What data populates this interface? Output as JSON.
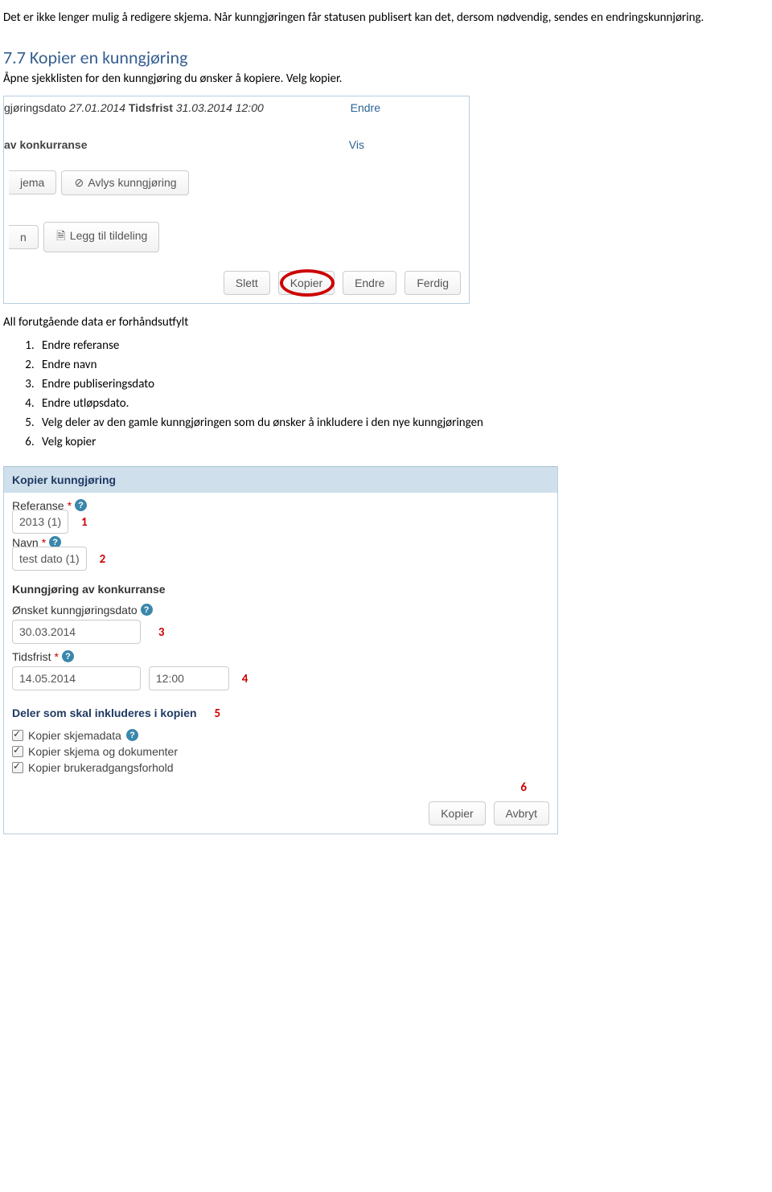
{
  "intro": {
    "p1": "Det er ikke lenger mulig å redigere skjema. Når kunngjøringen får statusen publisert kan det, dersom nødvendig, sendes en endringskunnjøring."
  },
  "section": {
    "heading": "7.7 Kopier en kunngjøring",
    "sub": "Åpne sjekklisten for den kunngjøring du ønsker å kopiere. Velg kopier."
  },
  "shot1": {
    "row1_prefix": "gjøringsdato",
    "row1_date": "27.01.2014",
    "row1_tidsfrist_label": "Tidsfrist",
    "row1_tidsfrist_value": "31.03.2014 12:00",
    "row1_link": "Endre",
    "row2_prefix": "av konkurranse",
    "row2_link": "Vis",
    "btn_jema": "jema",
    "btn_avlys": "Avlys kunngjøring",
    "btn_n": "n",
    "btn_leggtil": "Legg til tildeling",
    "btn_slett": "Slett",
    "btn_kopier": "Kopier",
    "btn_endre": "Endre",
    "btn_ferdig": "Ferdig"
  },
  "midtext": "All forutgående data er forhåndsutfylt",
  "steps": [
    "Endre referanse",
    "Endre navn",
    "Endre publiseringsdato",
    "Endre utløpsdato.",
    "Velg deler av den gamle kunngjøringen som du ønsker å inkludere i den nye kunngjøringen",
    "Velg kopier"
  ],
  "form": {
    "header": "Kopier kunngjøring",
    "referanse_label": "Referanse",
    "referanse_value": "2013 (1)",
    "navn_label": "Navn",
    "navn_value": "test dato (1)",
    "sub1": "Kunngjøring av konkurranse",
    "onsket_label": "Ønsket kunngjøringsdato",
    "onsket_value": "30.03.2014",
    "tidsfrist_label": "Tidsfrist",
    "tidsfrist_date": "14.05.2014",
    "tidsfrist_time": "12:00",
    "sub2": "Deler som skal inkluderes i kopien",
    "chk1": "Kopier skjemadata",
    "chk2": "Kopier skjema og dokumenter",
    "chk3": "Kopier brukeradgangsforhold",
    "btn_kopier": "Kopier",
    "btn_avbryt": "Avbryt",
    "tags": {
      "t1": "1",
      "t2": "2",
      "t3": "3",
      "t4": "4",
      "t5": "5",
      "t6": "6"
    }
  }
}
